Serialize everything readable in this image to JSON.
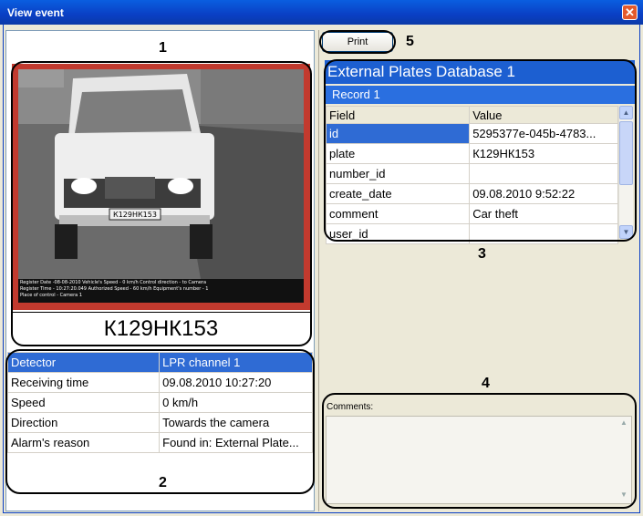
{
  "window": {
    "title": "View event",
    "close_glyph": "✕"
  },
  "callouts": {
    "n1": "1",
    "n2": "2",
    "n3": "3",
    "n4": "4",
    "n5": "5"
  },
  "photo": {
    "overlay_lines": [
      "Register Date -08-08-2010    Vehicle's Speed - 0 km/h Control direction - to Camera",
      "Register Time - 10:27:20.049  Authorized Speed - 60 km/h   Equipment's number - 1",
      "Place of control - Camera 1"
    ],
    "car_plate_text": "К129НК153"
  },
  "plate_number": "К129НК153",
  "details": [
    {
      "label": "Detector",
      "value": "LPR channel 1"
    },
    {
      "label": "Receiving time",
      "value": "09.08.2010 10:27:20"
    },
    {
      "label": "Speed",
      "value": "0 km/h"
    },
    {
      "label": "Direction",
      "value": "Towards the camera"
    },
    {
      "label": "Alarm's reason",
      "value": "Found in: External Plate..."
    }
  ],
  "print_label": "Print",
  "database": {
    "title": "External Plates Database 1",
    "record": "Record 1",
    "headers": {
      "field": "Field",
      "value": "Value"
    },
    "rows": [
      {
        "field": "id",
        "value": "5295377e-045b-4783..."
      },
      {
        "field": "plate",
        "value": "К129НК153"
      },
      {
        "field": "number_id",
        "value": ""
      },
      {
        "field": "create_date",
        "value": "09.08.2010 9:52:22"
      },
      {
        "field": "comment",
        "value": "Car theft"
      },
      {
        "field": "user_id",
        "value": ""
      }
    ]
  },
  "comments": {
    "label": "Comments:"
  },
  "colors": {
    "selection": "#2f6bd4",
    "header_blue": "#1c5fd1",
    "photo_border": "#c23a2e"
  }
}
